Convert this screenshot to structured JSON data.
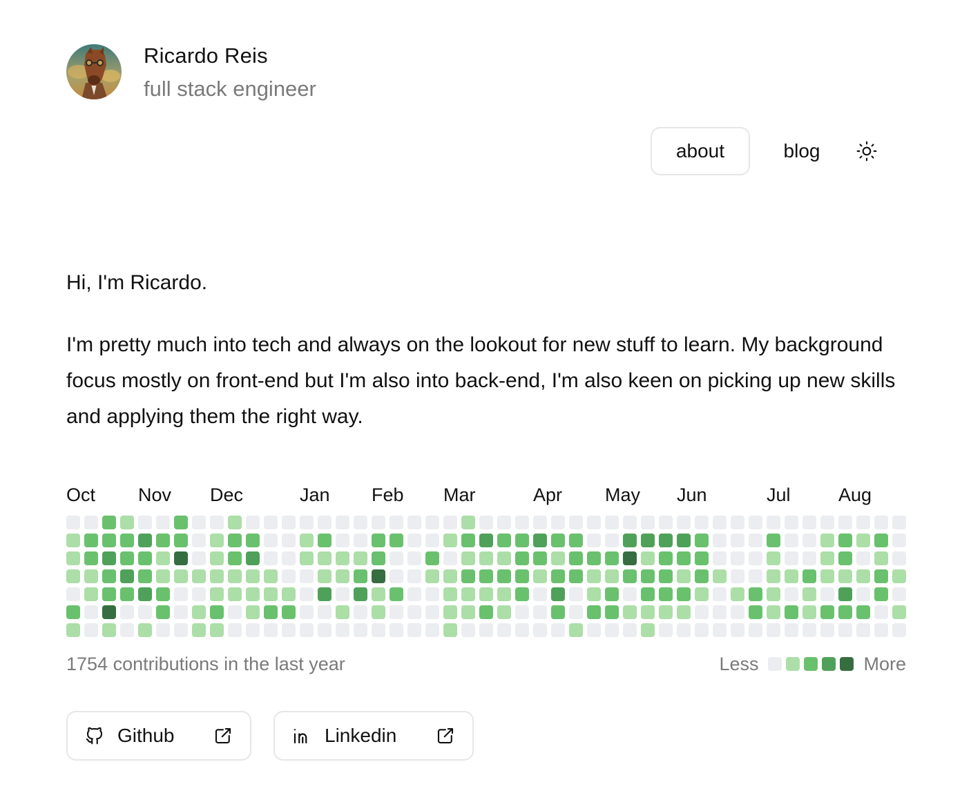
{
  "profile": {
    "name": "Ricardo Reis",
    "role": "full stack engineer"
  },
  "nav": {
    "about": "about",
    "blog": "blog",
    "theme_icon": "sun-icon"
  },
  "intro": {
    "greeting": "Hi, I'm Ricardo.",
    "bio": "I'm pretty much into tech and always on the lookout for new stuff to learn. My background focus mostly on front-end but I'm also into back-end, I'm also keen on picking up new skills and applying them the right way."
  },
  "contributions": {
    "months": [
      {
        "label": "Oct",
        "week": 0
      },
      {
        "label": "Nov",
        "week": 4
      },
      {
        "label": "Dec",
        "week": 8
      },
      {
        "label": "Jan",
        "week": 13
      },
      {
        "label": "Feb",
        "week": 17
      },
      {
        "label": "Mar",
        "week": 21
      },
      {
        "label": "Apr",
        "week": 26
      },
      {
        "label": "May",
        "week": 30
      },
      {
        "label": "Jun",
        "week": 34
      },
      {
        "label": "Jul",
        "week": 39
      },
      {
        "label": "Aug",
        "week": 43
      }
    ],
    "levels": [
      "0021002001000000000000100000000000000000000000011000000000",
      "1222322012200120022001232232200333320002001212012000000000",
      "1232214012300111120020111221222412220001001201010000000000",
      "1123211111110011240011222212211222121001121112110000000000",
      "0122320011111030312001111203012022210121010302020000000000",
      "2040020120122001010001121002022111100021212220100000000000",
      "1010100110000000000001000000100010000000000000020000000000"
    ],
    "total_text": "1754 contributions in the last year",
    "less_label": "Less",
    "more_label": "More",
    "colors": [
      "#ebedf0",
      "#acdea7",
      "#69c16d",
      "#4fa159",
      "#366e41"
    ]
  },
  "links": {
    "github": {
      "label": "Github",
      "icon": "github-icon",
      "external_icon": "external-link-icon"
    },
    "linkedin": {
      "label": "Linkedin",
      "icon": "linkedin-icon",
      "external_icon": "external-link-icon"
    }
  }
}
